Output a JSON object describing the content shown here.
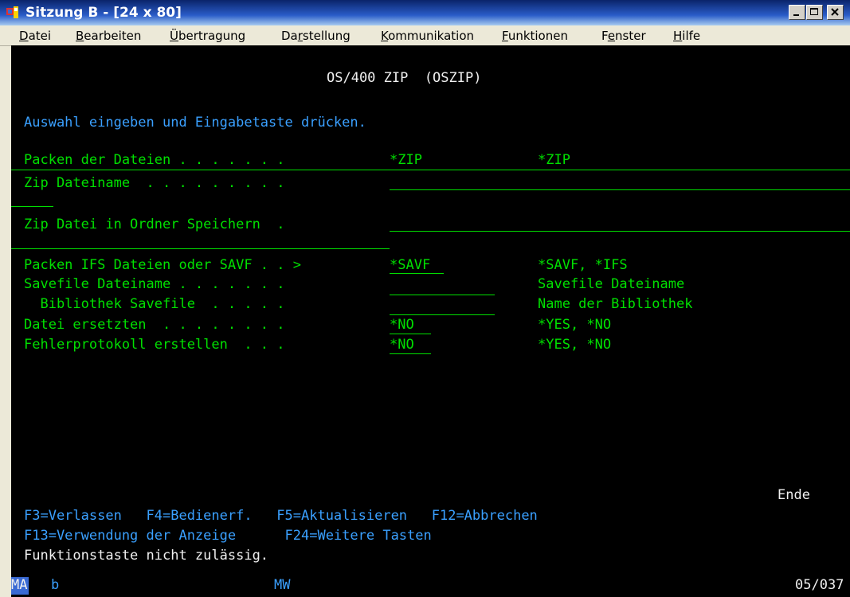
{
  "window": {
    "title": "Sitzung B - [24 x 80]",
    "buttons": [
      "minimize",
      "maximize",
      "close"
    ]
  },
  "menu": {
    "items": [
      {
        "label": "Datei",
        "hotkey": "D"
      },
      {
        "label": "Bearbeiten",
        "hotkey": "B"
      },
      {
        "label": "Übertragung",
        "hotkey": "Ü"
      },
      {
        "label": "Darstellung",
        "hotkey": "r"
      },
      {
        "label": "Kommunikation",
        "hotkey": "K"
      },
      {
        "label": "Funktionen",
        "hotkey": "F"
      },
      {
        "label": "Fenster",
        "hotkey": "e"
      },
      {
        "label": "Hilfe",
        "hotkey": "H"
      }
    ]
  },
  "screen": {
    "header": "OS/400 ZIP  (OSZIP)",
    "instruction": "Auswahl eingeben und Eingabetaste drücken.",
    "fields": [
      {
        "label": "Packen der Dateien . . . . . . .",
        "value": "*ZIP",
        "hint": "*ZIP"
      },
      {
        "label": "Zip Dateiname  . . . . . . . . .",
        "value": "",
        "hint": ""
      },
      {
        "label": "Zip Datei in Ordner Speichern  .",
        "value": "",
        "hint": ""
      },
      {
        "label": "Packen IFS Dateien oder SAVF . . >",
        "value": "*SAVF",
        "hint": "*SAVF, *IFS"
      },
      {
        "label": "Savefile Dateiname . . . . . . .",
        "value": "",
        "hint": "Savefile Dateiname"
      },
      {
        "label": "  Bibliothek Savefile  . . . . .",
        "value": "",
        "hint": "Name der Bibliothek"
      },
      {
        "label": "Datei ersetzten  . . . . . . . .",
        "value": "*NO",
        "hint": "*YES, *NO"
      },
      {
        "label": "Fehlerprotokoll erstellen  . . .",
        "value": "*NO",
        "hint": "*YES, *NO"
      }
    ],
    "end_marker": "Ende",
    "fkeys_line1": "F3=Verlassen   F4=Bedienerf.   F5=Aktualisieren   F12=Abbrechen",
    "fkeys_line2": "F13=Verwendung der Anzeige      F24=Weitere Tasten",
    "message": "Funktionstaste nicht zulässig."
  },
  "status": {
    "mode": "MA",
    "indicator_b": "b",
    "indicator_mw": "MW",
    "cursor": "05/037"
  },
  "colors": {
    "field_text": "#00e000",
    "instruction": "#3aa0ff",
    "message": "#f0f0f0",
    "background": "#000000"
  }
}
